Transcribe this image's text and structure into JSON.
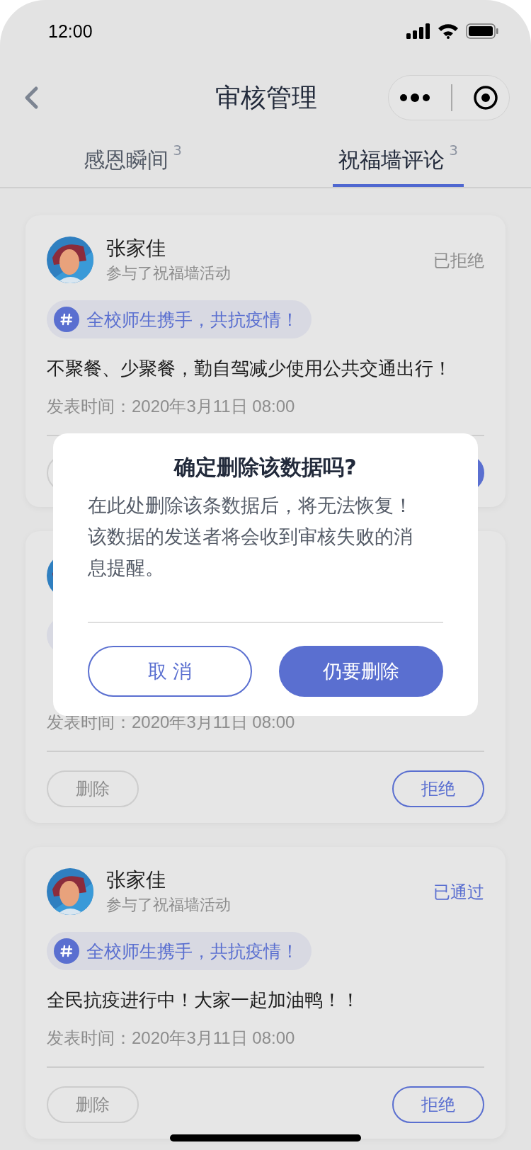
{
  "status_bar": {
    "time": "12:00"
  },
  "nav": {
    "title": "审核管理"
  },
  "tabs": [
    {
      "label": "感恩瞬间",
      "count": "3",
      "selected": false
    },
    {
      "label": "祝福墙评论",
      "count": "3",
      "selected": true
    }
  ],
  "cards": [
    {
      "name": "张家佳",
      "subtitle": "参与了祝福墙活动",
      "status": "已拒绝",
      "approved": false,
      "tag": "全校师生携手，共抗疫情！",
      "content": "不聚餐、少聚餐，勤自驾减少使用公共交通出行！",
      "time": "发表时间：2020年3月11日 08:00",
      "buttons": [
        {
          "kind": "delete"
        },
        {
          "kind": "approve"
        }
      ]
    },
    {
      "time": "发表时间：2020年3月11日 08:00",
      "buttons": [
        {
          "kind": "delete",
          "label": "删除"
        },
        {
          "kind": "reject",
          "label": "拒绝"
        }
      ]
    },
    {
      "name": "张家佳",
      "subtitle": "参与了祝福墙活动",
      "status": "已通过",
      "approved": true,
      "tag": "全校师生携手，共抗疫情！",
      "content": "全民抗疫进行中！大家一起加油鸭！！",
      "time": "发表时间：2020年3月11日 08:00",
      "buttons": [
        {
          "kind": "delete",
          "label": "删除"
        },
        {
          "kind": "reject",
          "label": "拒绝"
        }
      ]
    }
  ],
  "dialog": {
    "title": "确定删除该数据吗?",
    "message_lines": [
      "在此处删除该条数据后，将无法恢复！",
      "该数据的发送者将会收到审核失败的消息提醒。"
    ],
    "cancel": "取 消",
    "confirm": "仍要删除"
  }
}
